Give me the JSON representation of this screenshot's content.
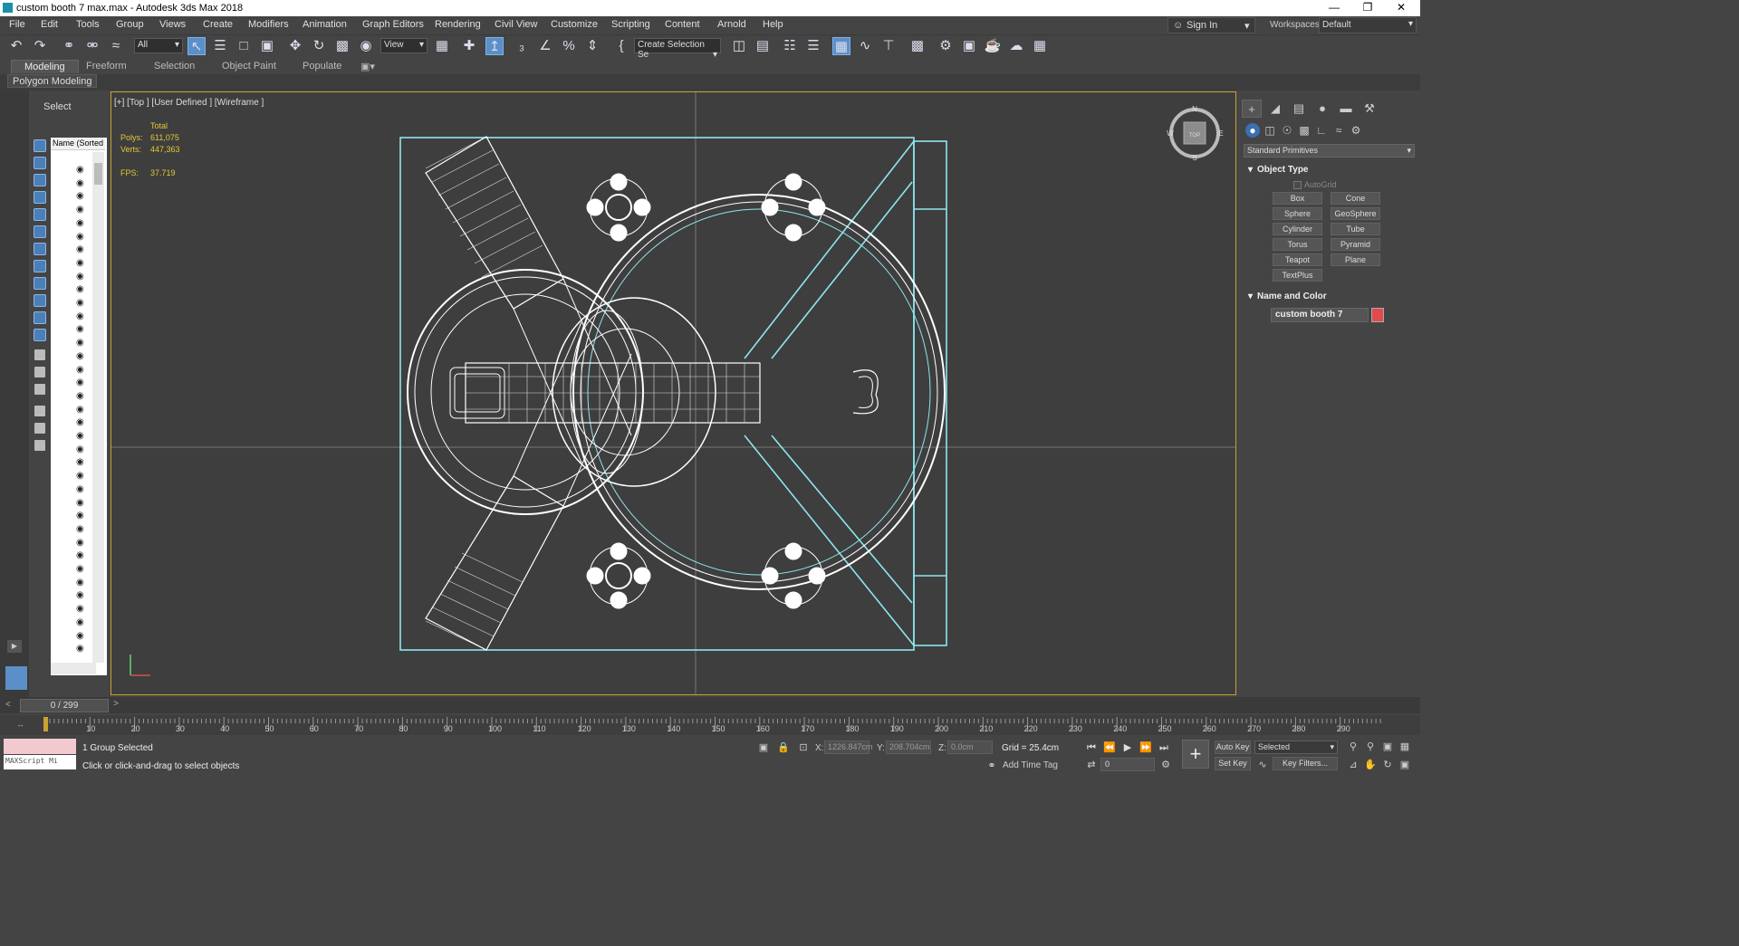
{
  "window": {
    "title": "custom booth 7 max.max - Autodesk 3ds Max 2018"
  },
  "menu": [
    "File",
    "Edit",
    "Tools",
    "Group",
    "Views",
    "Create",
    "Modifiers",
    "Animation",
    "Graph Editors",
    "Rendering",
    "Civil View",
    "Customize",
    "Scripting",
    "Content",
    "Arnold",
    "Help"
  ],
  "account": {
    "sign_in": "Sign In",
    "workspaces_label": "Workspaces:",
    "workspace": "Default"
  },
  "toolbar": {
    "selection_filter": "All",
    "ref_coord": "View",
    "named_selection": "Create Selection Se"
  },
  "ribbon": {
    "tabs": [
      "Modeling",
      "Freeform",
      "Selection",
      "Object Paint",
      "Populate"
    ],
    "active_tab": "Modeling",
    "panel_label": "Polygon Modeling"
  },
  "explorer": {
    "title": "Select",
    "column_header": "Name (Sorted A"
  },
  "viewport": {
    "label": "[+] [Top ] [User Defined ] [Wireframe ]",
    "stats": {
      "total_label": "Total",
      "polys_label": "Polys:",
      "polys": "611,075",
      "verts_label": "Verts:",
      "verts": "447,363",
      "fps_label": "FPS:",
      "fps": "37.719"
    },
    "viewcube": {
      "n": "N",
      "s": "S",
      "e": "E",
      "w": "W",
      "face": "TOP"
    }
  },
  "command_panel": {
    "primitive_set": "Standard Primitives",
    "object_type_title": "Object Type",
    "autogrid": "AutoGrid",
    "primitives": [
      "Box",
      "Cone",
      "Sphere",
      "GeoSphere",
      "Cylinder",
      "Tube",
      "Torus",
      "Pyramid",
      "Teapot",
      "Plane",
      "TextPlus"
    ],
    "name_color_title": "Name and Color",
    "object_name": "custom booth 7",
    "object_color": "#e14b4b"
  },
  "timeline": {
    "frame_display": "0 / 299",
    "ticks": [
      "10",
      "20",
      "30",
      "40",
      "50",
      "60",
      "70",
      "80",
      "90",
      "100",
      "110",
      "120",
      "130",
      "140",
      "150",
      "160",
      "170",
      "180",
      "190",
      "200",
      "210",
      "220",
      "230",
      "240",
      "250",
      "260",
      "270",
      "280",
      "290"
    ]
  },
  "status": {
    "maxscript_label": "MAXScript Mi",
    "selection": "1 Group Selected",
    "hint": "Click or click-and-drag to select objects",
    "x_label": "X:",
    "x": "1226.847cm",
    "y_label": "Y:",
    "y": "208.704cm",
    "z_label": "Z:",
    "z": "0.0cm",
    "grid": "Grid = 25.4cm",
    "add_time_tag": "Add Time Tag",
    "frame": "0",
    "auto_key": "Auto Key",
    "set_key": "Set Key",
    "key_mode": "Selected",
    "key_filters": "Key Filters..."
  }
}
